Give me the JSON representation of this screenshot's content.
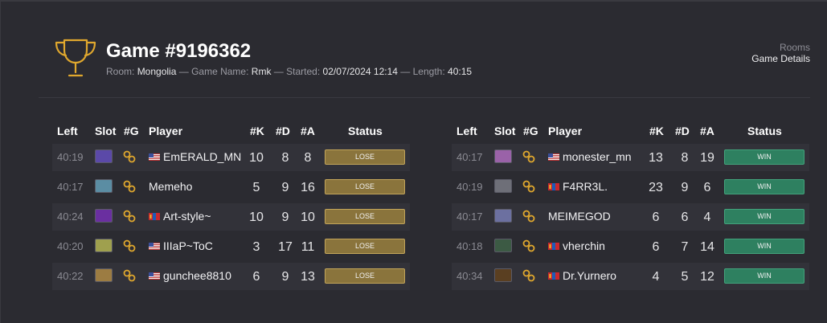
{
  "header": {
    "title": "Game #9196362",
    "room_label": "Room:",
    "room": "Mongolia",
    "sep1": "—",
    "game_name_label": "Game Name:",
    "game_name": "Rmk",
    "sep2": "—",
    "started_label": "Started:",
    "started": "02/07/2024 12:14",
    "sep3": "—",
    "length_label": "Length:",
    "length": "40:15"
  },
  "breadcrumb": {
    "rooms": "Rooms",
    "current": "Game Details"
  },
  "columns": {
    "left": "Left",
    "slot": "Slot",
    "g": "#G",
    "player": "Player",
    "k": "#K",
    "d": "#D",
    "a": "#A",
    "status": "Status"
  },
  "colors": {
    "lose_bg": "#8a743c",
    "win_bg": "#2e8060",
    "accent": "#e0a82e"
  },
  "team_left": [
    {
      "left": "40:19",
      "slot_color": "#5b49a8",
      "flag": "us-flag-icon",
      "player": "EmERALD_MN",
      "k": "10",
      "d": "8",
      "a": "8",
      "status": "LOSE"
    },
    {
      "left": "40:17",
      "slot_color": "#5b8da3",
      "flag": "",
      "player": "Memeho",
      "k": "5",
      "d": "9",
      "a": "16",
      "status": "LOSE"
    },
    {
      "left": "40:24",
      "slot_color": "#6a2fa0",
      "flag": "mn-flag-icon",
      "player": "Art-style~",
      "k": "10",
      "d": "9",
      "a": "10",
      "status": "LOSE"
    },
    {
      "left": "40:20",
      "slot_color": "#9fa04e",
      "flag": "us-flag-icon",
      "player": "IIIaP~ToC",
      "k": "3",
      "d": "17",
      "a": "11",
      "status": "LOSE"
    },
    {
      "left": "40:22",
      "slot_color": "#9c7c42",
      "flag": "us-flag-icon",
      "player": "gunchee8810",
      "k": "6",
      "d": "9",
      "a": "13",
      "status": "LOSE"
    }
  ],
  "team_right": [
    {
      "left": "40:17",
      "slot_color": "#9a62a8",
      "flag": "us-flag-icon",
      "player": "monester_mn",
      "k": "13",
      "d": "8",
      "a": "19",
      "status": "WIN"
    },
    {
      "left": "40:19",
      "slot_color": "#6e6f78",
      "flag": "mn-flag-icon",
      "player": "F4RR3L.",
      "k": "23",
      "d": "9",
      "a": "6",
      "status": "WIN"
    },
    {
      "left": "40:17",
      "slot_color": "#6c70a0",
      "flag": "",
      "player": "MEIMEGOD",
      "k": "6",
      "d": "6",
      "a": "4",
      "status": "WIN"
    },
    {
      "left": "40:18",
      "slot_color": "#3c5a44",
      "flag": "mn-flag-icon",
      "player": "vherchin",
      "k": "6",
      "d": "7",
      "a": "14",
      "status": "WIN"
    },
    {
      "left": "40:34",
      "slot_color": "#5a3f21",
      "flag": "mn-flag-icon",
      "player": "Dr.Yurnero",
      "k": "4",
      "d": "5",
      "a": "12",
      "status": "WIN"
    }
  ]
}
